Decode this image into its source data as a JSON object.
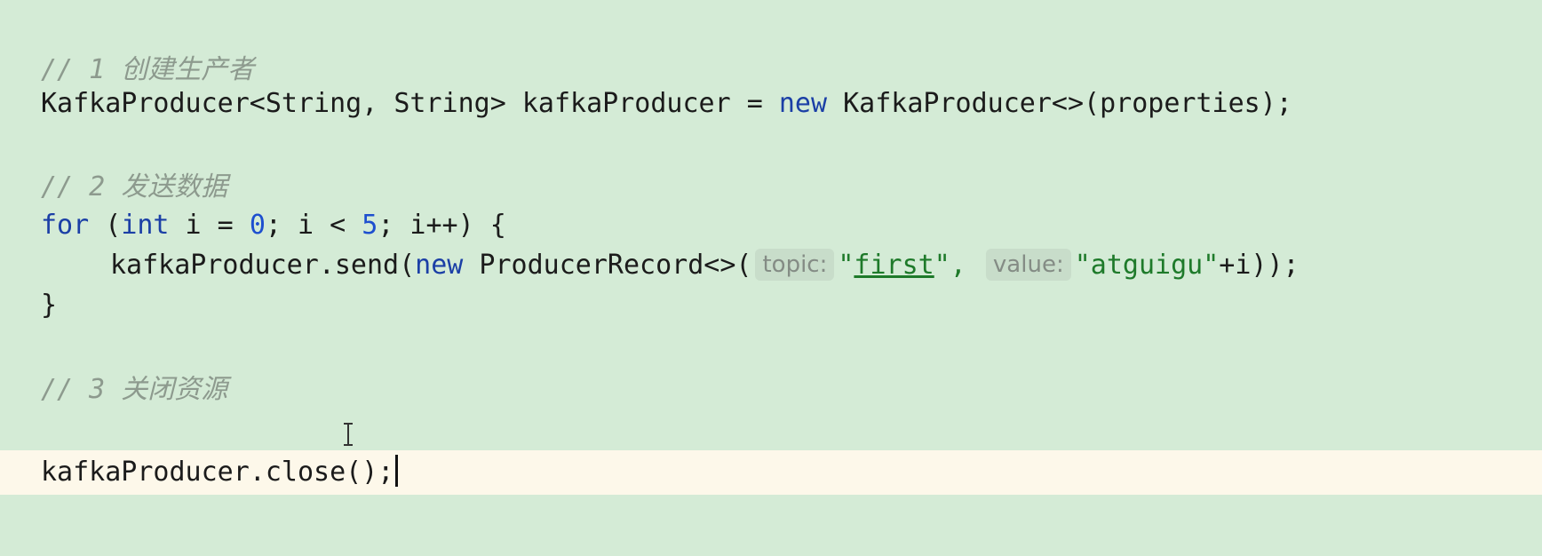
{
  "code": {
    "comment_1": "// 1 创建生产者",
    "line_create": {
      "decl": "KafkaProducer<String, String> kafkaProducer = ",
      "kw_new": "new",
      "rest": " KafkaProducer<>(properties);"
    },
    "comment_2": "// 2 发送数据",
    "line_for": {
      "kw_for": "for",
      "p1": " (",
      "kw_int": "int",
      "p2": " i = ",
      "zero": "0",
      "p3": "; i < ",
      "five": "5",
      "p4": "; i++) {"
    },
    "line_send": {
      "call": "kafkaProducer.send(",
      "kw_new": "new",
      "ctor": " ProducerRecord<>(",
      "hint_topic": "topic:",
      "quote_open": "\"",
      "topic_value": "first",
      "quote_close_comma": "\", ",
      "hint_value": "value:",
      "value_str": "\"atguigu\"",
      "tail": "+i));"
    },
    "line_close_brace": "}",
    "comment_3": "// 3 关闭资源",
    "line_close": "kafkaProducer.close();"
  }
}
